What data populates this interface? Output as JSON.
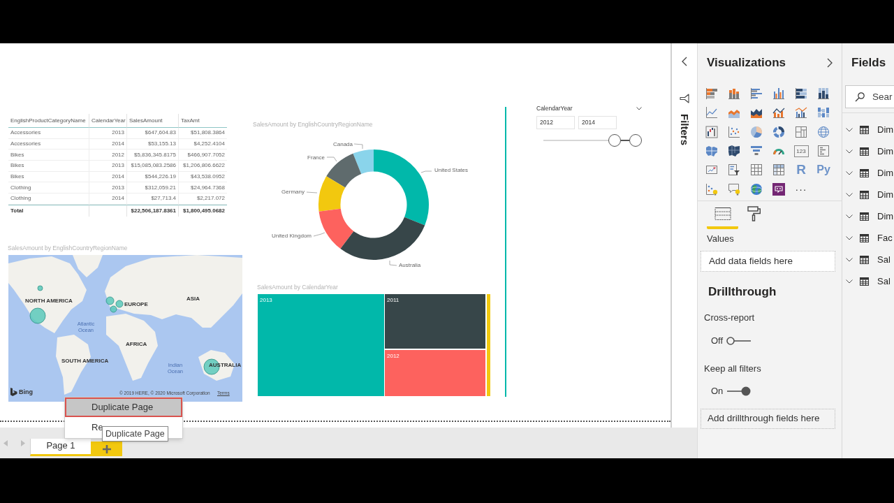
{
  "report_canvas": {
    "table": {
      "columns": [
        "EnglishProductCategoryName",
        "CalendarYear",
        "SalesAmount",
        "TaxAmt"
      ],
      "rows": [
        [
          "Accessories",
          "2013",
          "$647,604.83",
          "$51,808.3864"
        ],
        [
          "Accessories",
          "2014",
          "$53,155.13",
          "$4,252.4104"
        ],
        [
          "Bikes",
          "2012",
          "$5,836,345.8175",
          "$466,907.7052"
        ],
        [
          "Bikes",
          "2013",
          "$15,085,083.2586",
          "$1,206,806.6622"
        ],
        [
          "Bikes",
          "2014",
          "$544,226.19",
          "$43,538.0952"
        ],
        [
          "Clothing",
          "2013",
          "$312,059.21",
          "$24,964.7368"
        ],
        [
          "Clothing",
          "2014",
          "$27,713.4",
          "$2,217.072"
        ]
      ],
      "total": {
        "label": "Total",
        "values": [
          "$22,506,187.8361",
          "$1,800,495.0682"
        ]
      }
    },
    "donut_chart": {
      "title": "SalesAmount by EnglishCountryRegionName",
      "slices": [
        {
          "label": "Canada",
          "color": "#8ad4eb"
        },
        {
          "label": "France",
          "color": "#5f6b6d"
        },
        {
          "label": "United States",
          "color": "#01b8aa"
        },
        {
          "label": "Germany",
          "color": "#f2c80f"
        },
        {
          "label": "United Kingdom",
          "color": "#fd625e"
        },
        {
          "label": "Australia",
          "color": "#374649"
        }
      ]
    },
    "slicer": {
      "title": "CalendarYear",
      "from": "2012",
      "to": "2014",
      "thumbs": [
        {
          "level": 0.77
        },
        {
          "level": 1
        }
      ]
    },
    "map": {
      "title": "SalesAmount by EnglishCountryRegionName",
      "labels": [
        {
          "text": "NORTH AMERICA",
          "kind": "continent"
        },
        {
          "text": "EUROPE",
          "kind": "continent"
        },
        {
          "text": "ASIA",
          "kind": "continent"
        },
        {
          "text": "Atlantic Ocean",
          "kind": "ocean"
        },
        {
          "text": "AFRICA",
          "kind": "continent"
        },
        {
          "text": "SOUTH AMERICA",
          "kind": "continent"
        },
        {
          "text": "Indian Ocean",
          "kind": "ocean"
        },
        {
          "text": "AUSTRALIA",
          "kind": "continent"
        }
      ],
      "logo": "Bing",
      "copyright": "© 2019 HERE, © 2020 Microsoft Corporation",
      "terms": "Terms"
    },
    "treemap": {
      "title": "SalesAmount by CalendarYear",
      "tiles": [
        {
          "label": "2013",
          "color": "#01b8aa"
        },
        {
          "label": "2011",
          "color": "#374649"
        },
        {
          "label": "2012",
          "color": "#fd625e"
        },
        {
          "color": "#f2c80f"
        }
      ]
    }
  },
  "filters_pane": {
    "title": "Filters"
  },
  "visualizations_pane": {
    "title": "Visualizations",
    "gallery": {
      "card_label": "123",
      "script_visuals": [
        "R",
        "Py"
      ],
      "more": "···"
    },
    "tabs": [
      {
        "selected": true
      },
      {
        "selected": false
      }
    ],
    "values_well": {
      "label": "Values",
      "placeholder": "Add data fields here"
    },
    "drillthrough": {
      "title": "Drillthrough",
      "toggles": [
        {
          "label": "Cross-report",
          "state_label": "Off",
          "on": false
        },
        {
          "label": "Keep all filters",
          "state_label": "On",
          "on": true
        }
      ],
      "placeholder": "Add drillthrough fields here"
    }
  },
  "fields_pane": {
    "title": "Fields",
    "search": {
      "placeholder": "Sear"
    },
    "tables": [
      "Dim",
      "Dim",
      "Dim",
      "Dim",
      "Dim",
      "Fac",
      "Sal",
      "Sal"
    ]
  },
  "page_tabs": [
    {
      "label": "Page 1",
      "selected": true
    }
  ],
  "context_menu": {
    "items": [
      {
        "label": "Duplicate Page",
        "selected": true
      },
      {
        "label": "Re",
        "selected": false
      }
    ]
  },
  "tooltip": {
    "text": "Duplicate Page"
  }
}
